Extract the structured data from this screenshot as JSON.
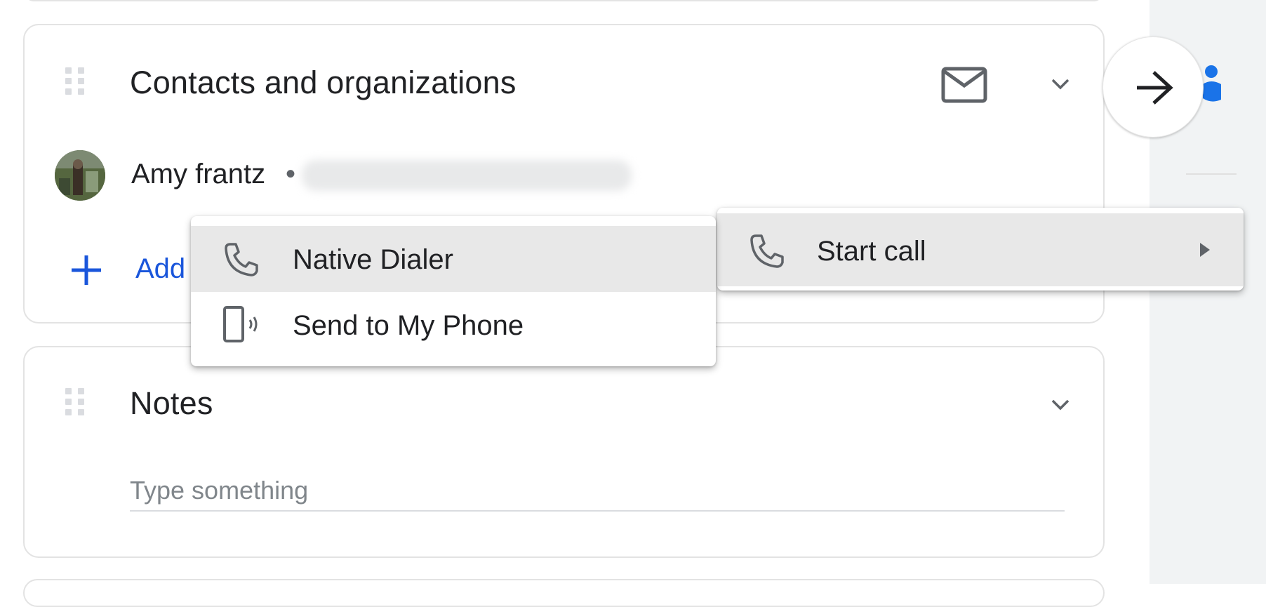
{
  "contacts_card": {
    "title": "Contacts and organizations",
    "contact": {
      "name": "Amy frantz",
      "separator": "•"
    },
    "add_label": "Add"
  },
  "notes_card": {
    "title": "Notes",
    "input_placeholder": "Type something"
  },
  "context_menu": {
    "start_call": {
      "label": "Start call",
      "icon": "phone-icon"
    },
    "submenu": [
      {
        "label": "Native Dialer",
        "icon": "phone-icon"
      },
      {
        "label": "Send to My Phone",
        "icon": "phone-send-icon"
      }
    ]
  },
  "colors": {
    "accent_blue": "#1a56db",
    "icon_gray": "#5f6368",
    "border": "#e3e3e3",
    "highlight": "#e8e8e8"
  }
}
